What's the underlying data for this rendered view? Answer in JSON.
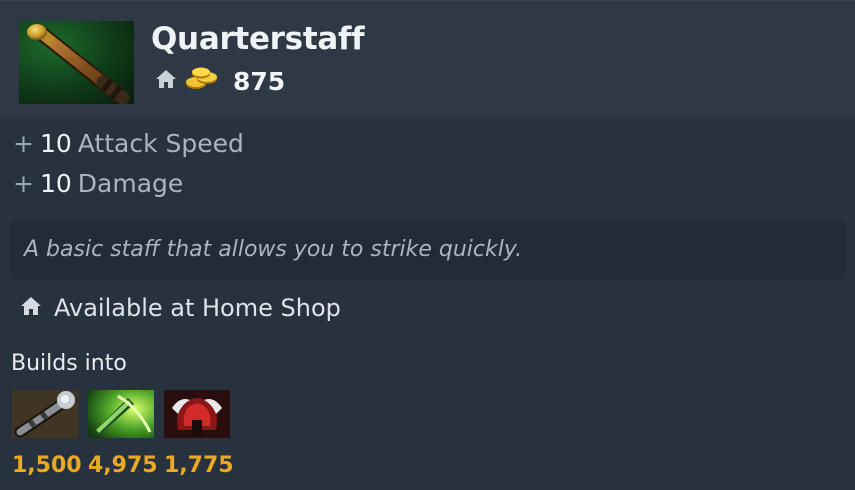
{
  "item": {
    "name": "Quarterstaff",
    "cost": "875",
    "icon": "quarterstaff-icon"
  },
  "stats": [
    {
      "plus": "+",
      "value": "10",
      "name": "Attack Speed"
    },
    {
      "plus": "+",
      "value": "10",
      "name": "Damage"
    }
  ],
  "lore": "A basic staff that allows you to strike quickly.",
  "availability": "Available at Home Shop",
  "builds_into": {
    "label": "Builds into",
    "items": [
      {
        "icon": "orb-staff-icon",
        "price": "1,500"
      },
      {
        "icon": "green-blade-icon",
        "price": "4,975"
      },
      {
        "icon": "red-armor-icon",
        "price": "1,775"
      }
    ]
  },
  "colors": {
    "gold": "#e9a923",
    "background": "#28323f",
    "header": "#2f3946"
  }
}
